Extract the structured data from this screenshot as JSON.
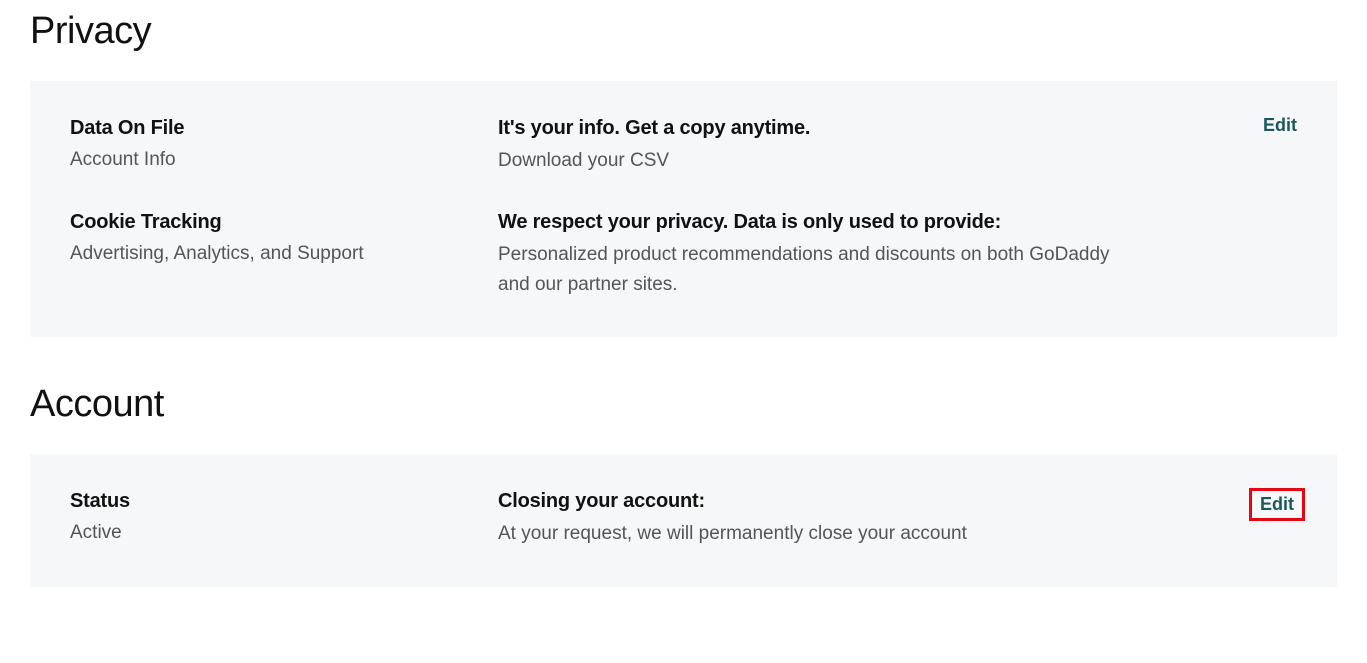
{
  "privacy": {
    "title": "Privacy",
    "rows": [
      {
        "left_title": "Data On File",
        "left_sub": "Account Info",
        "mid_title": "It's your info. Get a copy anytime.",
        "mid_sub": "Download your CSV",
        "edit_label": "Edit"
      },
      {
        "left_title": "Cookie Tracking",
        "left_sub": "Advertising, Analytics, and Support",
        "mid_title": "We respect your privacy. Data is only used to provide:",
        "mid_sub": "Personalized product recommendations and discounts on both GoDaddy and our partner sites."
      }
    ]
  },
  "account": {
    "title": "Account",
    "rows": [
      {
        "left_title": "Status",
        "left_sub": "Active",
        "mid_title": "Closing your account:",
        "mid_sub": "At your request, we will permanently close your account",
        "edit_label": "Edit"
      }
    ]
  }
}
